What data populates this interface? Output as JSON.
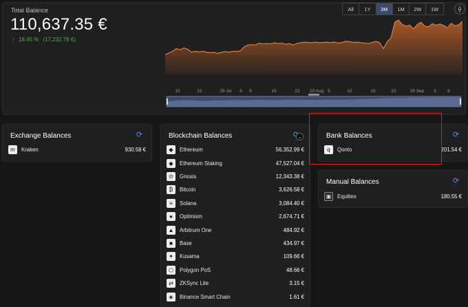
{
  "total": {
    "label": "Total Balance",
    "value": "110,637.35 €",
    "change_pct": "18.45 %",
    "change_abs": "(17,232.78 €)"
  },
  "ranges": [
    "All",
    "1Y",
    "3M",
    "1M",
    "2W",
    "1W"
  ],
  "active_range": "3M",
  "chart_data": {
    "type": "area",
    "x_ticks": [
      "15",
      "22",
      "29 Jul",
      "6",
      "8",
      "15",
      "22",
      "29 Aug",
      "5",
      "12",
      "15",
      "22",
      "29 Sep",
      "5",
      "8"
    ],
    "values": [
      54,
      58,
      63,
      70,
      67,
      72,
      68,
      60,
      63,
      61,
      63,
      60,
      59,
      60,
      57,
      60,
      62,
      60,
      63,
      62,
      64,
      75,
      80,
      81,
      80,
      85,
      83,
      84,
      83,
      86,
      84,
      85,
      82,
      84,
      80,
      84,
      86,
      88,
      87,
      86,
      88,
      86,
      87,
      88,
      86,
      88,
      85,
      87,
      90,
      89,
      87,
      88,
      86,
      85,
      84,
      87,
      90,
      86,
      70,
      89,
      99,
      142,
      148,
      136,
      131,
      134,
      124,
      136,
      142,
      131,
      130,
      138,
      134,
      137,
      133,
      127,
      139,
      132,
      135,
      145
    ],
    "overview_values": [
      20,
      24,
      26,
      24,
      22,
      25,
      24,
      26,
      25,
      26,
      27,
      25,
      26,
      28,
      26,
      27,
      26,
      28,
      27,
      28,
      29,
      30,
      31,
      33,
      35,
      34,
      36,
      35,
      37,
      36,
      38,
      37
    ],
    "ylim": [
      0,
      150
    ],
    "fill_color": "#c0622a",
    "line_color": "#e07b3c"
  },
  "exchange": {
    "title": "Exchange Balances",
    "items": [
      {
        "name": "Kraken",
        "amount": "930.58 €",
        "icon": "kraken-icon"
      }
    ]
  },
  "blockchain": {
    "title": "Blockchain Balances",
    "items": [
      {
        "name": "Ethereum",
        "amount": "56,352.99 €",
        "icon": "ethereum-icon"
      },
      {
        "name": "Ethereum Staking",
        "amount": "47,527.04 €",
        "icon": "ethereum-staking-icon"
      },
      {
        "name": "Gnosis",
        "amount": "12,343.38 €",
        "icon": "gnosis-icon"
      },
      {
        "name": "Bitcoin",
        "amount": "3,626.58 €",
        "icon": "bitcoin-icon"
      },
      {
        "name": "Solana",
        "amount": "3,084.40 €",
        "icon": "solana-icon"
      },
      {
        "name": "Optimism",
        "amount": "2,674.71 €",
        "icon": "optimism-icon"
      },
      {
        "name": "Arbitrum One",
        "amount": "484.92 €",
        "icon": "arbitrum-icon"
      },
      {
        "name": "Base",
        "amount": "434.97 €",
        "icon": "base-icon"
      },
      {
        "name": "Kusama",
        "amount": "109.66 €",
        "icon": "kusama-icon"
      },
      {
        "name": "Polygon PoS",
        "amount": "48.66 €",
        "icon": "polygon-icon"
      },
      {
        "name": "ZKSync Lite",
        "amount": "3.15 €",
        "icon": "zksync-icon"
      },
      {
        "name": "Binance Smart Chain",
        "amount": "1.61 €",
        "icon": "bnb-icon"
      }
    ]
  },
  "bank": {
    "title": "Bank Balances",
    "items": [
      {
        "name": "Qonto",
        "amount": "201.54 €",
        "icon": "qonto-icon"
      }
    ]
  },
  "manual": {
    "title": "Manual Balances",
    "items": [
      {
        "name": "Equities",
        "amount": "180.55 €",
        "icon": "equities-icon"
      }
    ]
  }
}
